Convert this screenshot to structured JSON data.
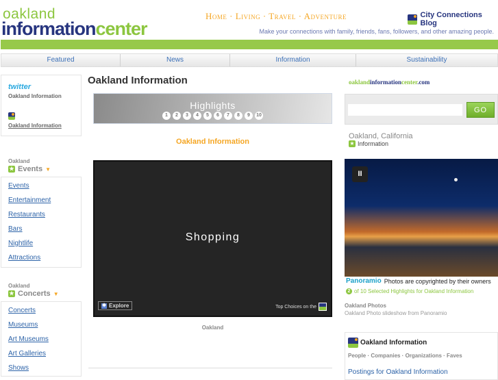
{
  "header": {
    "logo_top": "oakland",
    "logo_main": "information",
    "logo_accent": "center",
    "nav": "Home · Living · Travel · Adventure",
    "blog_link": "City Connections Blog",
    "tagline": "Make your connections with family, friends, fans, followers, and other amazing people."
  },
  "tabs": [
    "Featured",
    "News",
    "Information",
    "Sustainability"
  ],
  "left": {
    "twitter": "twitter",
    "twitter_name": "Oakland Information",
    "city_link": "Oakland Information",
    "events": {
      "small": "Oakland",
      "title": "Events",
      "links": [
        "Events",
        "Entertainment",
        "Restaurants",
        "Bars",
        "Nightlife",
        "Attractions"
      ]
    },
    "concerts": {
      "small": "Oakland",
      "title": "Concerts",
      "links": [
        "Concerts",
        "Museums",
        "Art Museums",
        "Art Galleries",
        "Shows"
      ]
    }
  },
  "center": {
    "title": "Oakland Information",
    "banner_title": "Highlights",
    "banner_numbers": [
      "1",
      "2",
      "3",
      "4",
      "5",
      "6",
      "7",
      "8",
      "9",
      "10"
    ],
    "subtitle": "Oakland Information",
    "video_title": "Shopping",
    "explore": "Explore",
    "top_choices": "Top Choices on the",
    "caption": "Oakland"
  },
  "right": {
    "site_a": "oakland",
    "site_b": "information",
    "site_c": "center",
    "site_d": ".com",
    "search_value": "",
    "go": "GO",
    "location": "Oakland, California",
    "info": "Information",
    "panoramio": "Panoramio",
    "copyright": "Photos are copyrighted by their owners",
    "highlight_num": "2",
    "highlight_text": "of 10 Selected Highlights for Oakland Information",
    "photos_title": "Oakland Photos",
    "photos_sub": "Oakland Photo slideshow from Panoramio",
    "box_title": "Oakland Information",
    "box_links": "People · Companies · Organizations · Faves",
    "postings": "Postings for Oakland Information"
  }
}
